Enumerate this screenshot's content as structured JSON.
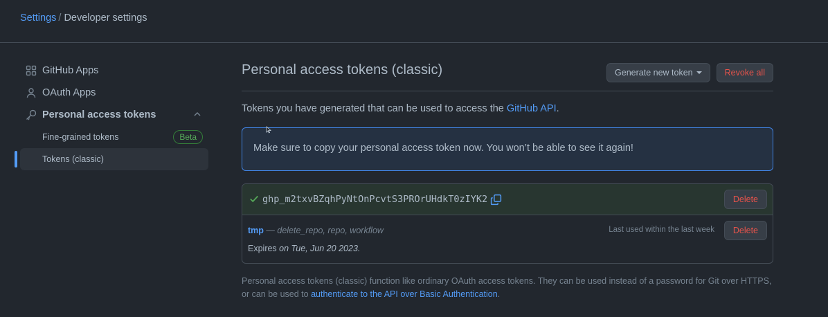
{
  "breadcrumb": {
    "root": "Settings",
    "separator": "/",
    "current": "Developer settings"
  },
  "sidebar": {
    "items": [
      {
        "label": "GitHub Apps",
        "icon": "apps-icon"
      },
      {
        "label": "OAuth Apps",
        "icon": "person-icon"
      },
      {
        "label": "Personal access tokens",
        "icon": "key-icon"
      }
    ],
    "subitems": [
      {
        "label": "Fine-grained tokens",
        "badge": "Beta"
      },
      {
        "label": "Tokens (classic)"
      }
    ]
  },
  "main": {
    "title": "Personal access tokens (classic)",
    "generate_label": "Generate new token",
    "revoke_label": "Revoke all",
    "intro_text": "Tokens you have generated that can be used to access the ",
    "intro_link": "GitHub API",
    "intro_end": ".",
    "flash": "Make sure to copy your personal access token now. You won’t be able to see it again!",
    "new_token": {
      "value": "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",
      "delete_label": "Delete"
    },
    "token": {
      "name": "tmp",
      "scopes": " — delete_repo, repo, workflow",
      "last_used": "Last used within the last week",
      "expires_label": "Expires ",
      "expires_date": "on Tue, Jun 20 2023.",
      "delete_label": "Delete"
    },
    "footer_text": "Personal access tokens (classic) function like ordinary OAuth access tokens. They can be used instead of a password for Git over HTTPS, or can be used to ",
    "footer_link": "authenticate to the API over Basic Authentication",
    "footer_end": "."
  },
  "colors": {
    "accent": "#539bf5",
    "danger": "#e5534b",
    "success": "#57ab5a",
    "background": "#22272e"
  }
}
